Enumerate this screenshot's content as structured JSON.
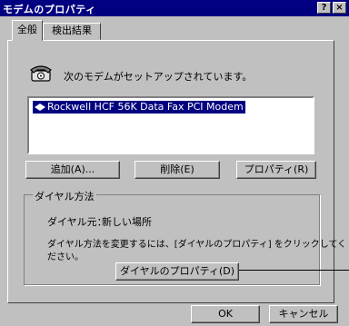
{
  "window": {
    "title": "モデムのプロパティ",
    "help_button": "?",
    "close_button": "×"
  },
  "tabs": [
    {
      "label": "全般"
    },
    {
      "label": "検出結果"
    }
  ],
  "general": {
    "intro_text": "次のモデムがセットアップされています。",
    "modem_list": [
      {
        "name": "Rockwell HCF 56K Data Fax PCI Modem"
      }
    ],
    "buttons": {
      "add": "追加(A)...",
      "remove": "削除(E)",
      "properties": "プロパティ(R)"
    },
    "dialing": {
      "group_label": "ダイヤル方法",
      "from_label": "ダイヤル元：",
      "from_value": "新しい場所",
      "instructions_line1": "ダイヤル方法を変更するには、[ダイヤルのプロパティ] をクリックしてく",
      "instructions_line2": "ださい。",
      "dialing_properties_button": "ダイヤルのプロパティ(D)"
    }
  },
  "footer": {
    "ok": "OK",
    "cancel": "キャンセル"
  }
}
